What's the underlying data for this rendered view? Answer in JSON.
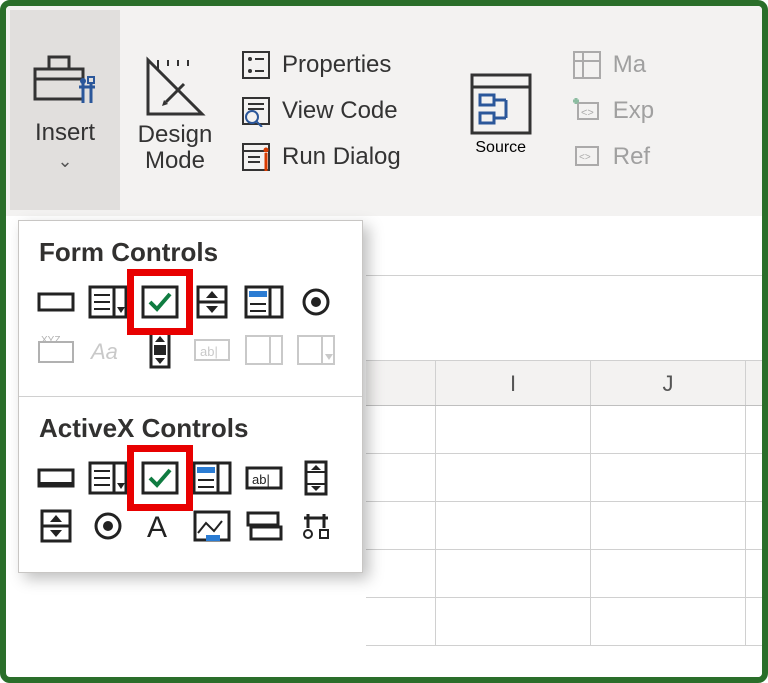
{
  "ribbon": {
    "insert": "Insert",
    "design1": "Design",
    "design2": "Mode",
    "properties": "Properties",
    "viewcode": "View Code",
    "rundialog": "Run Dialog",
    "source": "Source",
    "map": "Ma",
    "expansion": "Exp",
    "refresh": "Ref"
  },
  "dropdown": {
    "section1": "Form Controls",
    "section2": "ActiveX Controls"
  },
  "columns": {
    "c1": "I",
    "c2": "J"
  }
}
